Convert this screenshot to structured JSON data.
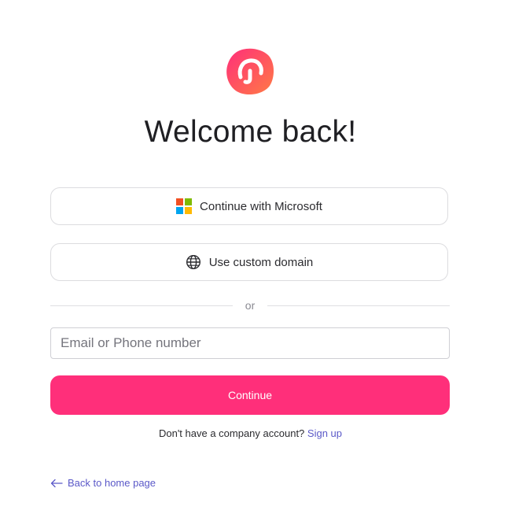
{
  "brand": {
    "logo_icon": "brand-logo-icon",
    "logo_color_start": "#ff2f7a",
    "logo_color_end": "#ff7a45"
  },
  "heading": {
    "title": "Welcome back!"
  },
  "sso": {
    "microsoft_label": "Continue with Microsoft",
    "microsoft_icon": "microsoft-logo-icon",
    "domain_label": "Use custom domain",
    "domain_icon": "globe-icon"
  },
  "divider": {
    "text": "or"
  },
  "login_form": {
    "email_placeholder": "Email or Phone number",
    "email_value": "",
    "continue_label": "Continue"
  },
  "signup": {
    "prompt": "Don't have a company account?",
    "link_label": "Sign up"
  },
  "footer": {
    "back_label": "Back to home page",
    "back_icon": "arrow-left-icon"
  },
  "colors": {
    "primary": "#ff2f7a",
    "link": "#5b59c8",
    "border": "#dcdcdf"
  }
}
